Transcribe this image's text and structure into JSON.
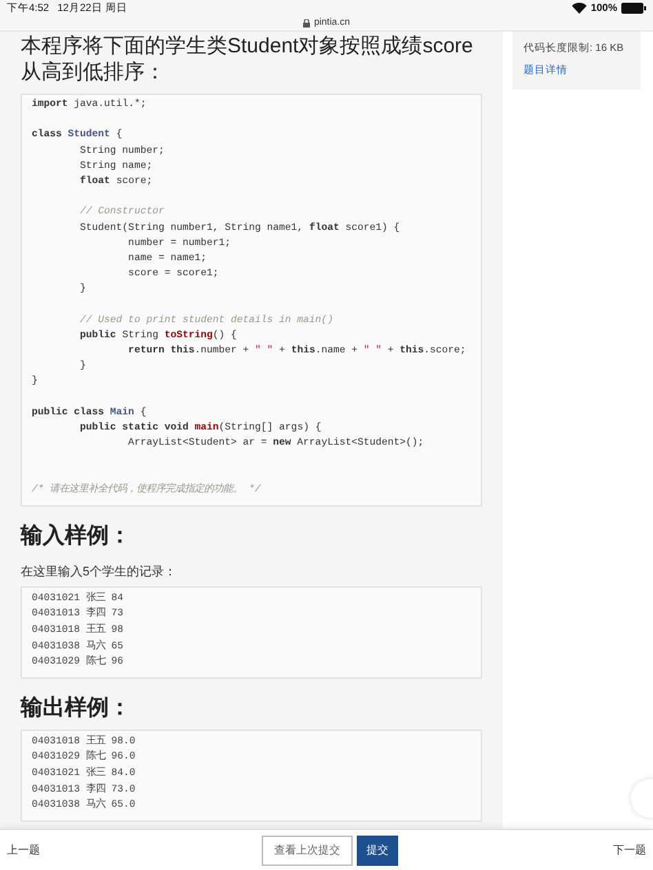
{
  "status_bar": {
    "time": "下午4:52",
    "date": "12月22日 周日",
    "battery": "100%"
  },
  "address_bar": {
    "url": "pintia.cn"
  },
  "problem": {
    "heading_lines": [
      "本程序将下面的学生类Student对象按照成绩score",
      "从高到低排序："
    ]
  },
  "side_panel": {
    "items": [
      {
        "kind": "text",
        "text": "代码长度限制: 16 KB"
      },
      {
        "kind": "link",
        "text": "题目详情"
      }
    ]
  },
  "code_block": {
    "lines": [
      {
        "kind": "code",
        "segments": [
          {
            "kind": "keyword",
            "text": "import"
          },
          {
            "kind": "plain",
            "text": " java.util.*;"
          }
        ]
      },
      {
        "kind": "blank"
      },
      {
        "kind": "code",
        "segments": [
          {
            "kind": "keyword",
            "text": "class"
          },
          {
            "kind": "type",
            "text": " Student"
          },
          {
            "kind": "plain",
            "text": " {"
          }
        ]
      },
      {
        "kind": "code",
        "segments": [
          {
            "kind": "plain",
            "text": "        String number;"
          }
        ]
      },
      {
        "kind": "code",
        "segments": [
          {
            "kind": "plain",
            "text": "        String name;"
          }
        ]
      },
      {
        "kind": "code",
        "segments": [
          {
            "kind": "keyword",
            "text": "        float"
          },
          {
            "kind": "plain",
            "text": " score;"
          }
        ]
      },
      {
        "kind": "blank"
      },
      {
        "kind": "code",
        "segments": [
          {
            "kind": "comment",
            "text": "        // Constructor"
          }
        ]
      },
      {
        "kind": "code",
        "segments": [
          {
            "kind": "plain",
            "text": "        Student(String number1, String name1, "
          },
          {
            "kind": "keyword",
            "text": "float"
          },
          {
            "kind": "plain",
            "text": " score1) {"
          }
        ]
      },
      {
        "kind": "code",
        "segments": [
          {
            "kind": "plain",
            "text": "                number = number1;"
          }
        ]
      },
      {
        "kind": "code",
        "segments": [
          {
            "kind": "plain",
            "text": "                name = name1;"
          }
        ]
      },
      {
        "kind": "code",
        "segments": [
          {
            "kind": "plain",
            "text": "                score = score1;"
          }
        ]
      },
      {
        "kind": "code",
        "segments": [
          {
            "kind": "plain",
            "text": "        }"
          }
        ]
      },
      {
        "kind": "blank"
      },
      {
        "kind": "code",
        "segments": [
          {
            "kind": "comment",
            "text": "        // Used to print student details in main()"
          }
        ]
      },
      {
        "kind": "code",
        "segments": [
          {
            "kind": "keyword",
            "text": "        public"
          },
          {
            "kind": "plain",
            "text": " String "
          },
          {
            "kind": "function",
            "text": "toString"
          },
          {
            "kind": "plain",
            "text": "() {"
          }
        ]
      },
      {
        "kind": "code",
        "segments": [
          {
            "kind": "keyword",
            "text": "                return this"
          },
          {
            "kind": "plain",
            "text": ".number + "
          },
          {
            "kind": "string",
            "text": "\" \""
          },
          {
            "kind": "plain",
            "text": " + "
          },
          {
            "kind": "keyword",
            "text": "this"
          },
          {
            "kind": "plain",
            "text": ".name + "
          },
          {
            "kind": "string",
            "text": "\" \""
          },
          {
            "kind": "plain",
            "text": " + "
          },
          {
            "kind": "keyword",
            "text": "this"
          },
          {
            "kind": "plain",
            "text": ".score;"
          }
        ]
      },
      {
        "kind": "code",
        "segments": [
          {
            "kind": "plain",
            "text": "        }"
          }
        ]
      },
      {
        "kind": "code",
        "segments": [
          {
            "kind": "plain",
            "text": "}"
          }
        ]
      },
      {
        "kind": "blank"
      },
      {
        "kind": "code",
        "segments": [
          {
            "kind": "keyword",
            "text": "public class"
          },
          {
            "kind": "type",
            "text": " Main"
          },
          {
            "kind": "plain",
            "text": " {"
          }
        ]
      },
      {
        "kind": "code",
        "segments": [
          {
            "kind": "keyword",
            "text": "        public static void"
          },
          {
            "kind": "function",
            "text": " main"
          },
          {
            "kind": "plain",
            "text": "(String[] args) {"
          }
        ]
      },
      {
        "kind": "code",
        "segments": [
          {
            "kind": "plain",
            "text": "                ArrayList<Student> ar = "
          },
          {
            "kind": "keyword",
            "text": "new"
          },
          {
            "kind": "plain",
            "text": " ArrayList<Student>();"
          }
        ]
      },
      {
        "kind": "blank"
      },
      {
        "kind": "blank"
      },
      {
        "kind": "code",
        "segments": [
          {
            "kind": "comment",
            "text": "/* 请在这里补全代码，使程序完成指定的功能。 */"
          }
        ]
      }
    ]
  },
  "input_sample": {
    "heading": "输入样例：",
    "description": "在这里输入5个学生的记录：",
    "lines": [
      "04031021 张三 84",
      "04031013 李四 73",
      "04031018 王五 98",
      "04031038 马六 65",
      "04031029 陈七 96"
    ]
  },
  "output_sample": {
    "heading": "输出样例：",
    "lines": [
      "04031018 王五 98.0",
      "04031029 陈七 96.0",
      "04031021 张三 84.0",
      "04031013 李四 73.0",
      "04031038 马六 65.0"
    ]
  },
  "footer": {
    "previous": "上一题",
    "buttons": [
      {
        "kind": "outline",
        "label": "查看上次提交"
      },
      {
        "kind": "primary",
        "label": "提交"
      }
    ],
    "next": "下一题"
  }
}
